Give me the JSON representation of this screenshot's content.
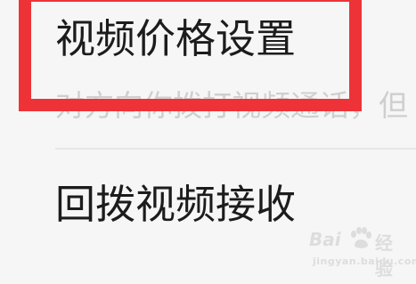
{
  "settings": {
    "items": [
      {
        "title": "视频价格设置",
        "description": "对方向你拨打视频通话，但"
      },
      {
        "title": "回拨视频接收"
      }
    ]
  },
  "annotation": {
    "color": "#ee3338"
  },
  "watermark": {
    "logo": "Bai",
    "brand": "经验",
    "url": "jingyan.baidu.com"
  }
}
